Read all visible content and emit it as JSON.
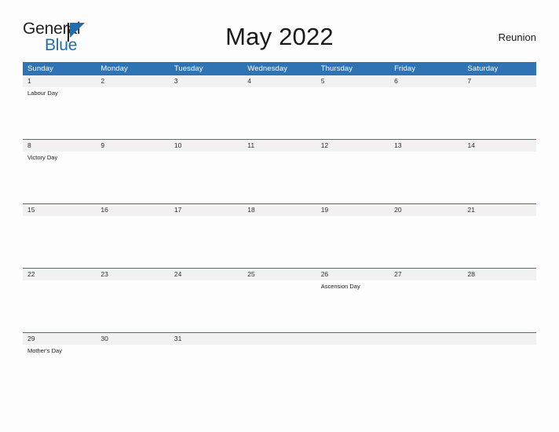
{
  "brand": {
    "name_part1": "General",
    "name_part2": "Blue",
    "triangle_color": "#1f6cb0"
  },
  "header": {
    "title": "May 2022",
    "region": "Reunion"
  },
  "theme": {
    "header_blue": "#2e74b5",
    "band_gray": "#f1f1f1",
    "page_background": "#fdfdfd",
    "text_dark": "#1a1a1a"
  },
  "calendar": {
    "month": "May",
    "year": "2022",
    "weekday_headers": [
      "Sunday",
      "Monday",
      "Tuesday",
      "Wednesday",
      "Thursday",
      "Friday",
      "Saturday"
    ],
    "weeks": [
      {
        "days": [
          {
            "number": "1",
            "events": [
              "Labour Day"
            ]
          },
          {
            "number": "2",
            "events": []
          },
          {
            "number": "3",
            "events": []
          },
          {
            "number": "4",
            "events": []
          },
          {
            "number": "5",
            "events": []
          },
          {
            "number": "6",
            "events": []
          },
          {
            "number": "7",
            "events": []
          }
        ]
      },
      {
        "days": [
          {
            "number": "8",
            "events": [
              "Victory Day"
            ]
          },
          {
            "number": "9",
            "events": []
          },
          {
            "number": "10",
            "events": []
          },
          {
            "number": "11",
            "events": []
          },
          {
            "number": "12",
            "events": []
          },
          {
            "number": "13",
            "events": []
          },
          {
            "number": "14",
            "events": []
          }
        ]
      },
      {
        "days": [
          {
            "number": "15",
            "events": []
          },
          {
            "number": "16",
            "events": []
          },
          {
            "number": "17",
            "events": []
          },
          {
            "number": "18",
            "events": []
          },
          {
            "number": "19",
            "events": []
          },
          {
            "number": "20",
            "events": []
          },
          {
            "number": "21",
            "events": []
          }
        ]
      },
      {
        "days": [
          {
            "number": "22",
            "events": []
          },
          {
            "number": "23",
            "events": []
          },
          {
            "number": "24",
            "events": []
          },
          {
            "number": "25",
            "events": []
          },
          {
            "number": "26",
            "events": [
              "Ascension Day"
            ]
          },
          {
            "number": "27",
            "events": []
          },
          {
            "number": "28",
            "events": []
          }
        ]
      },
      {
        "days": [
          {
            "number": "29",
            "events": [
              "Mother's Day"
            ]
          },
          {
            "number": "30",
            "events": []
          },
          {
            "number": "31",
            "events": []
          },
          {
            "number": "",
            "events": []
          },
          {
            "number": "",
            "events": []
          },
          {
            "number": "",
            "events": []
          },
          {
            "number": "",
            "events": []
          }
        ]
      }
    ]
  }
}
